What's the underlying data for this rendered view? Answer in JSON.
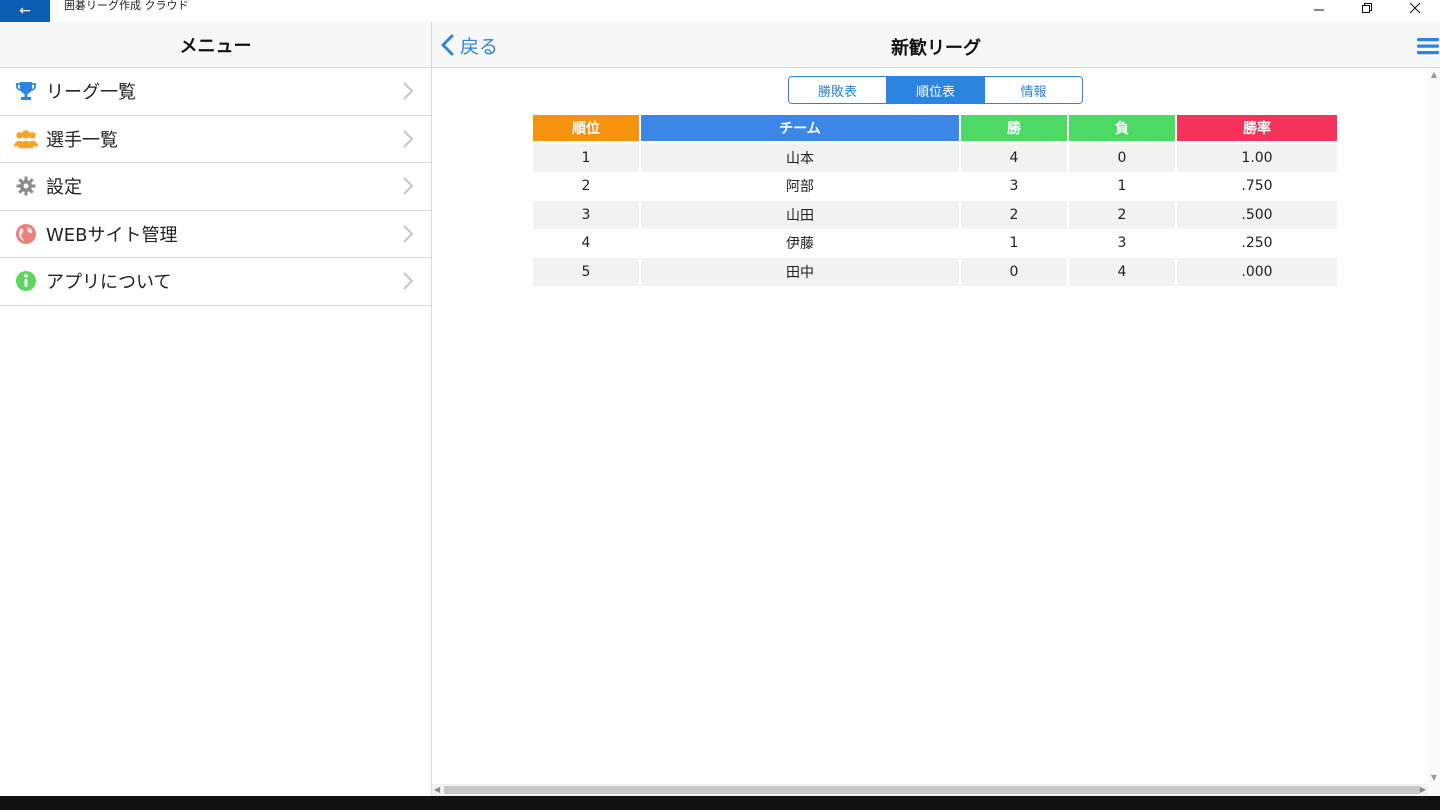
{
  "window": {
    "title": "囲碁リーグ作成 クラウド",
    "controls": [
      "minimize",
      "restore",
      "close"
    ]
  },
  "sidebar": {
    "title": "メニュー",
    "items": [
      {
        "label": "リーグ一覧",
        "icon": "trophy-icon"
      },
      {
        "label": "選手一覧",
        "icon": "people-icon"
      },
      {
        "label": "設定",
        "icon": "gear-icon"
      },
      {
        "label": "WEBサイト管理",
        "icon": "globe-icon"
      },
      {
        "label": "アプリについて",
        "icon": "info-icon"
      }
    ]
  },
  "header": {
    "back_label": "戻る",
    "title": "新歓リーグ"
  },
  "tabs": [
    {
      "label": "勝敗表",
      "active": false
    },
    {
      "label": "順位表",
      "active": true
    },
    {
      "label": "情報",
      "active": false
    }
  ],
  "standings": {
    "columns": [
      {
        "label": "順位",
        "color": "#f7920f"
      },
      {
        "label": "チーム",
        "color": "#3b86e6"
      },
      {
        "label": "勝",
        "color": "#4cd964"
      },
      {
        "label": "負",
        "color": "#4cd964"
      },
      {
        "label": "勝率",
        "color": "#f5325a"
      }
    ],
    "rows": [
      [
        "1",
        "山本",
        "4",
        "0",
        "1.00"
      ],
      [
        "2",
        "阿部",
        "3",
        "1",
        ".750"
      ],
      [
        "3",
        "山田",
        "2",
        "2",
        ".500"
      ],
      [
        "4",
        "伊藤",
        "1",
        "3",
        ".250"
      ],
      [
        "5",
        "田中",
        "0",
        "4",
        ".000"
      ]
    ]
  },
  "colors": {
    "accent": "#2a84e0",
    "titlebar_back": "#0a5fb4"
  }
}
